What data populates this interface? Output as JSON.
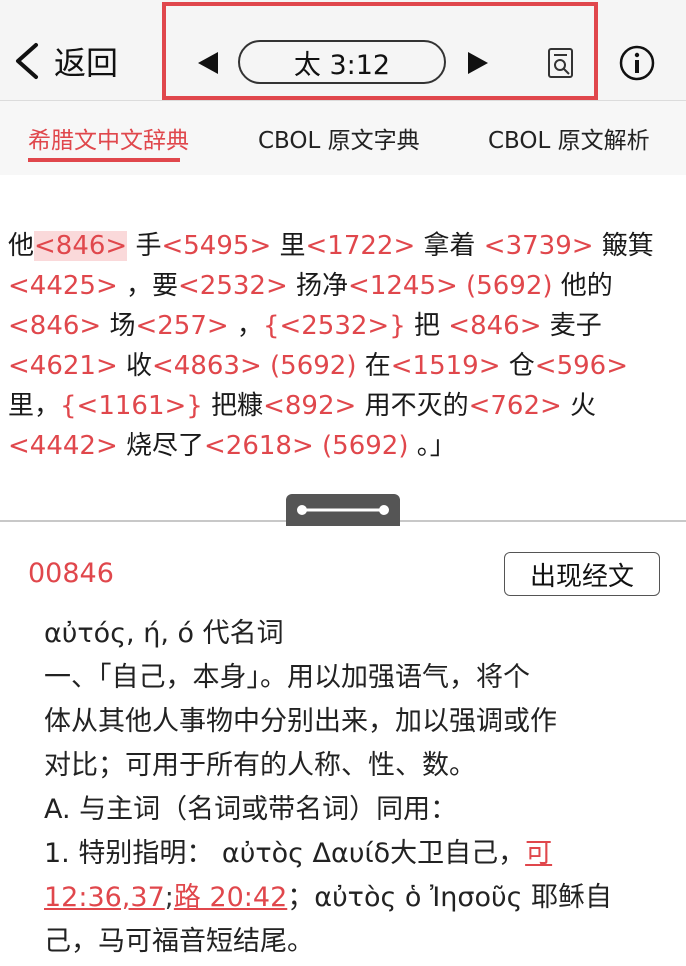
{
  "header": {
    "back_label": "返回",
    "verse_ref": "太 3:12"
  },
  "tabs": [
    {
      "label": "希腊文中文辞典",
      "active": true
    },
    {
      "label": "CBOL 原文字典",
      "active": false
    },
    {
      "label": "CBOL 原文解析",
      "active": false
    }
  ],
  "verse": {
    "lines": [
      [
        {
          "t": "他"
        },
        {
          "n": "<846>",
          "sel": true
        },
        {
          "t": " 手"
        },
        {
          "n": "<5495>"
        },
        {
          "t": " 里"
        },
        {
          "n": "<1722>"
        },
        {
          "t": " 拿着 "
        },
        {
          "n": "<3739>"
        },
        {
          "t": " 簸箕"
        }
      ],
      [
        {
          "n": "<4425>"
        },
        {
          "t": " ，要"
        },
        {
          "n": "<2532>"
        },
        {
          "t": " 扬净"
        },
        {
          "n": "<1245>"
        },
        {
          "t": " "
        },
        {
          "n": "(5692)"
        },
        {
          "t": " 他的"
        }
      ],
      [
        {
          "n": "<846>"
        },
        {
          "t": " 场"
        },
        {
          "n": "<257>"
        },
        {
          "t": " ，"
        },
        {
          "n": "{<2532>}"
        },
        {
          "t": " 把 "
        },
        {
          "n": "<846>"
        },
        {
          "t": " 麦子"
        }
      ],
      [
        {
          "n": "<4621>"
        },
        {
          "t": " 收"
        },
        {
          "n": "<4863>"
        },
        {
          "t": " "
        },
        {
          "n": "(5692)"
        },
        {
          "t": " 在"
        },
        {
          "n": "<1519>"
        },
        {
          "t": " 仓"
        },
        {
          "n": "<596>"
        }
      ],
      [
        {
          "t": "里，"
        },
        {
          "n": "{<1161>}"
        },
        {
          "t": " 把糠"
        },
        {
          "n": "<892>"
        },
        {
          "t": " 用不灭的"
        },
        {
          "n": "<762>"
        },
        {
          "t": " 火"
        }
      ],
      [
        {
          "n": "<4442>"
        },
        {
          "t": " 烧尽了"
        },
        {
          "n": "<2618>"
        },
        {
          "t": " "
        },
        {
          "n": "(5692)"
        },
        {
          "t": " 。」"
        }
      ]
    ]
  },
  "entry": {
    "id": "00846",
    "occurrences_label": "出现经文",
    "lines": [
      [
        {
          "t": "αὐτός, ή, ό  代名词"
        }
      ],
      [
        {
          "t": "一、「自己，本身」。用以加强语气，将个"
        }
      ],
      [
        {
          "t": "体从其他人事物中分别出来，加以强调或作"
        }
      ],
      [
        {
          "t": "对比；可用于所有的人称、性、数。"
        }
      ],
      [
        {
          "t": "A. 与主词（名词或带名词）同用："
        }
      ],
      [
        {
          "t": "1. 特别指明： αὐτὸς Δαυίδ大卫自己，"
        },
        {
          "r": "可"
        }
      ],
      [
        {
          "r": "12:36,37"
        },
        {
          "s": ";"
        },
        {
          "r": "路 20:42"
        },
        {
          "t": "；αὐτὸς ὁ Ἰησοῦς 耶稣自"
        }
      ],
      [
        {
          "t": "己，马可福音短结尾。"
        }
      ]
    ]
  },
  "colors": {
    "accent": "#e0474c",
    "selected_bg": "#fad9da"
  }
}
